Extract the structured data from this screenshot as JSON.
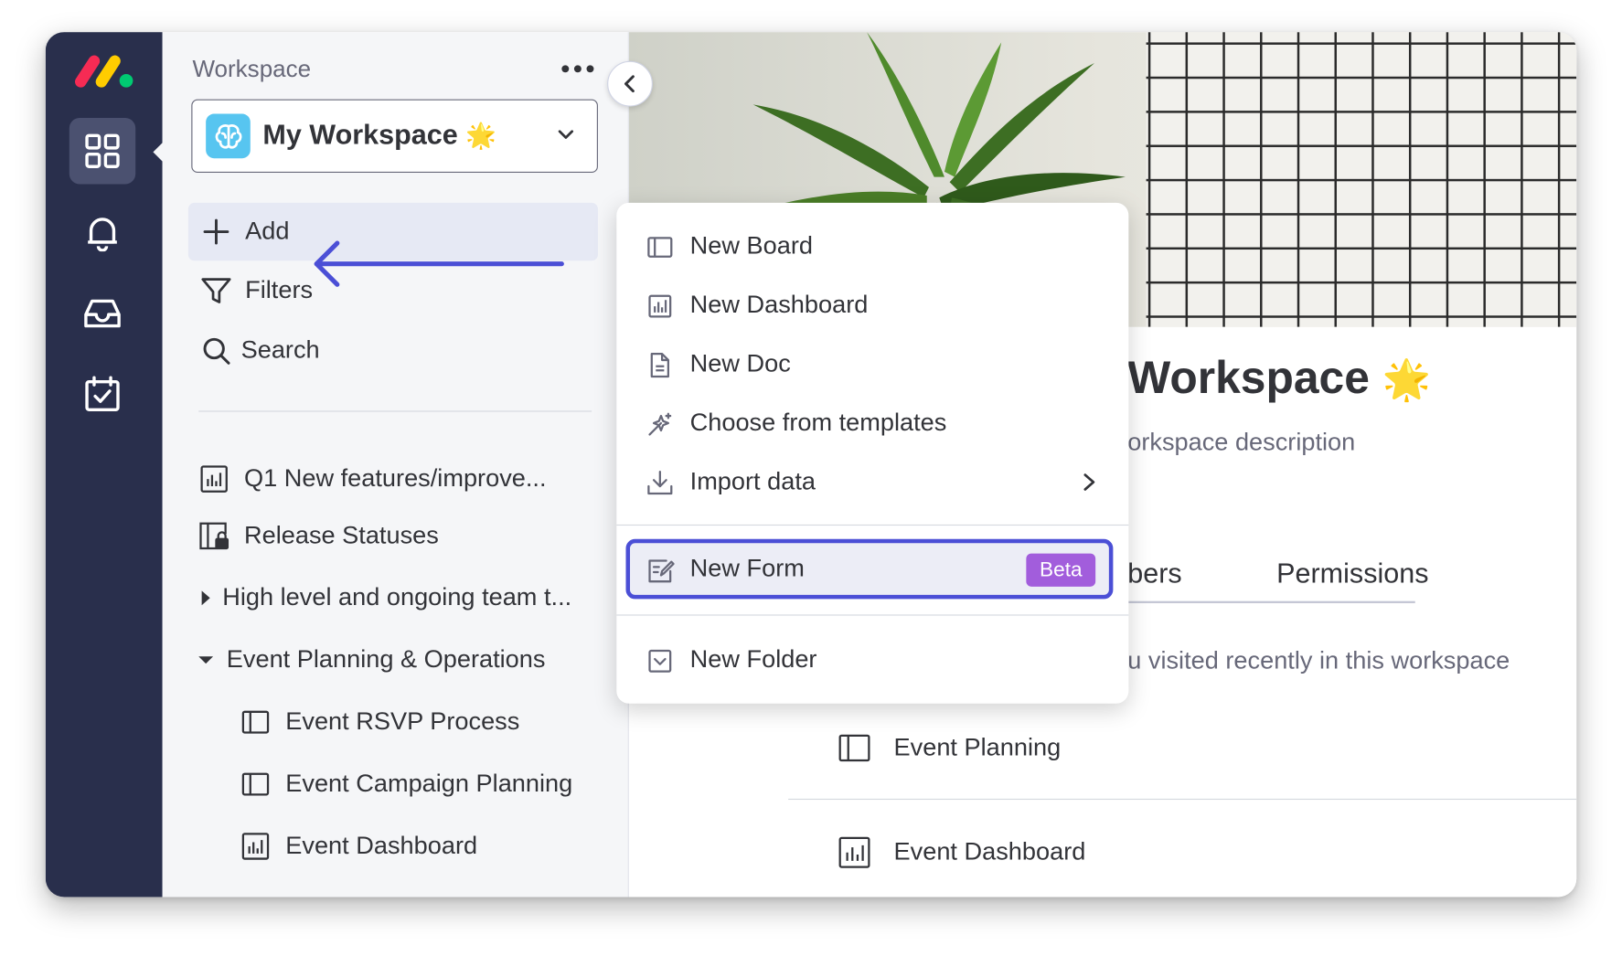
{
  "colors": {
    "rail": "#292f4c",
    "accent": "#4b4fd6",
    "beta": "#a25ddc",
    "arrow": "#4b4fd6"
  },
  "sidebar": {
    "title": "Workspace",
    "more_icon": "more-dots-icon",
    "workspace": {
      "name": "My Workspace",
      "emoji": "🌟",
      "avatar_icon": "brain-icon"
    },
    "nav": [
      {
        "label": "Add",
        "icon": "plus-icon"
      },
      {
        "label": "Filters",
        "icon": "filter-icon"
      },
      {
        "label": "Search",
        "icon": "search-icon"
      }
    ],
    "tree": [
      {
        "label": "Q1 New features/improve...",
        "icon": "dashboard-icon"
      },
      {
        "label": "Release Statuses",
        "icon": "locked-board-icon"
      },
      {
        "label": "High level and ongoing team t...",
        "icon": "caret-right-icon"
      },
      {
        "label": "Event Planning & Operations",
        "icon": "caret-down-icon"
      },
      {
        "label": "Event RSVP Process",
        "icon": "board-icon"
      },
      {
        "label": "Event Campaign Planning",
        "icon": "board-icon"
      },
      {
        "label": "Event Dashboard",
        "icon": "dashboard-icon"
      }
    ]
  },
  "rail": {
    "icons": [
      "apps-grid-icon",
      "bell-icon",
      "inbox-icon",
      "my-work-icon"
    ]
  },
  "menu": {
    "items": [
      {
        "label": "New Board",
        "icon": "board-icon"
      },
      {
        "label": "New Dashboard",
        "icon": "dashboard-icon"
      },
      {
        "label": "New Doc",
        "icon": "doc-icon"
      },
      {
        "label": "Choose from templates",
        "icon": "templates-icon"
      },
      {
        "label": "Import data",
        "icon": "import-icon"
      }
    ],
    "highlighted": {
      "label": "New Form",
      "badge": "Beta",
      "icon": "form-icon"
    },
    "folder": {
      "label": "New Folder",
      "icon": "folder-icon"
    }
  },
  "main": {
    "title": "Workspace",
    "title_emoji": "🌟",
    "description": "orkspace description",
    "tabs": [
      "bers",
      "Permissions"
    ],
    "recent_note": "u visited recently in this workspace",
    "recent": [
      {
        "label": "Event Planning",
        "icon": "board-icon"
      },
      {
        "label": "Event Dashboard",
        "icon": "dashboard-icon"
      }
    ]
  }
}
